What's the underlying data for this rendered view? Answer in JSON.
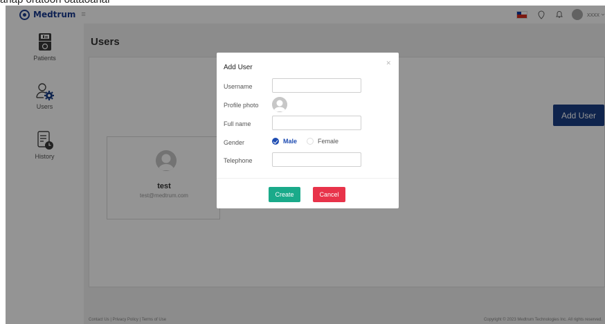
{
  "top_fragment": "anap oratoon oataoanar",
  "header": {
    "logo_text": "Medtrum",
    "user_name": "xxxx"
  },
  "sidebar": {
    "items": [
      {
        "label": "Patients",
        "icon": "patients-icon"
      },
      {
        "label": "Users",
        "icon": "users-gear-icon"
      },
      {
        "label": "History",
        "icon": "history-icon"
      }
    ]
  },
  "main": {
    "page_title": "Users",
    "add_user_label": "Add User",
    "users": [
      {
        "name": "test",
        "email": "test@medtrum.com"
      }
    ]
  },
  "modal": {
    "title": "Add User",
    "fields": {
      "username_label": "Username",
      "username_value": "",
      "profile_photo_label": "Profile photo",
      "full_name_label": "Full name",
      "full_name_value": "",
      "gender_label": "Gender",
      "gender_options": [
        "Male",
        "Female"
      ],
      "gender_selected": "Male",
      "telephone_label": "Telephone",
      "telephone_value": ""
    },
    "create_label": "Create",
    "cancel_label": "Cancel"
  },
  "footer": {
    "links": "Contact Us | Privacy Policy | Terms of Use",
    "copyright": "Copyright © 2023 Medtrum Technologies Inc. All rights reserved."
  },
  "colors": {
    "brand": "#1a3c8f",
    "primary_button": "#1a3f86",
    "create_button": "#1aaa8a",
    "cancel_button": "#e8334a",
    "overlay": "rgba(0,0,0,0.42)"
  }
}
